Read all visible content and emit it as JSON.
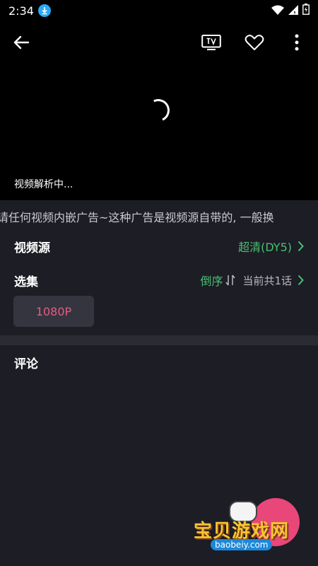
{
  "status_bar": {
    "time": "2:34"
  },
  "player": {
    "status_text": "视频解析中..."
  },
  "notice": {
    "text": "请任何视频内嵌广告~这种广告是视频源自带的, 一般换"
  },
  "source": {
    "label": "视频源",
    "value": "超清(DY5)"
  },
  "episodes": {
    "label": "选集",
    "order_label": "倒序",
    "total_text": "当前共1话",
    "items": [
      "1080P"
    ]
  },
  "comments": {
    "label": "评论"
  },
  "watermark": {
    "text": "宝贝游戏网",
    "url": "baobeiy.com"
  },
  "colors": {
    "accent_green": "#4cbf74",
    "accent_pink": "#e45c85",
    "background": "#1c1d25"
  }
}
